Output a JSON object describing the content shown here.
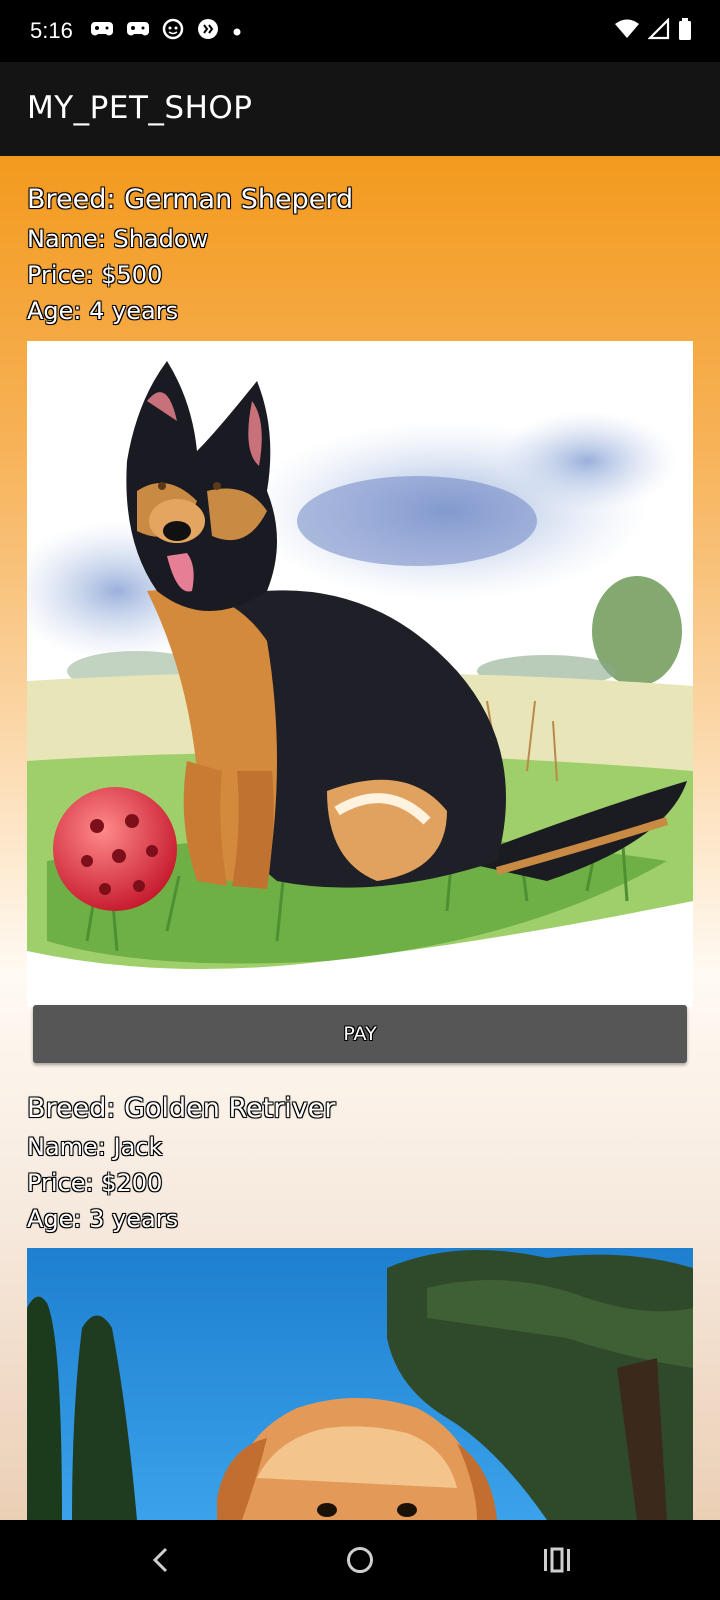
{
  "status_bar": {
    "time": "5:16",
    "left_icons": [
      "game-controller-icon",
      "game-controller-icon",
      "cat-face-icon",
      "chat-bubble-icon",
      "dot-icon"
    ],
    "right_icons": [
      "wifi-icon",
      "cell-signal-icon",
      "battery-icon"
    ]
  },
  "app_bar": {
    "title": "MY_PET_SHOP"
  },
  "pets": [
    {
      "breed": "Breed: German Sheperd",
      "name": "Name: Shadow",
      "price": "Price: $500",
      "age": "Age: 4 years",
      "image": "german-shepherd-watercolor-with-red-ball",
      "pay_label": "PAY"
    },
    {
      "breed": "Breed: Golden Retriver",
      "name": "Name: Jack",
      "price": "Price: $200",
      "age": "Age: 3 years",
      "image": "golden-retriever-under-blue-sky"
    }
  ],
  "nav_bar": {
    "buttons": [
      "back-icon",
      "home-icon",
      "recents-icon"
    ]
  },
  "colors": {
    "app_bar": "#141414",
    "gradient_top": "#f39a1e",
    "pay_button": "#565656"
  }
}
